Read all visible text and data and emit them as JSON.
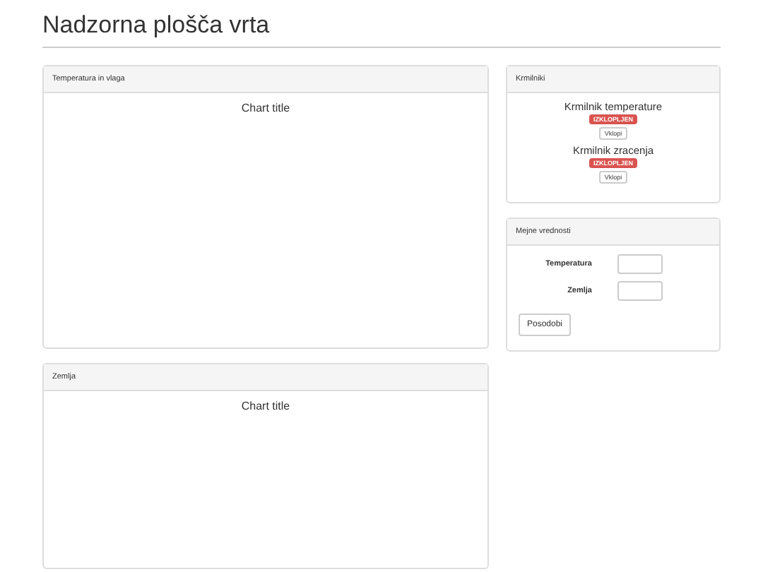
{
  "page_title": "Nadzorna plošča vrta",
  "charts": [
    {
      "heading": "Temperatura in vlaga",
      "chart_title": "Chart title"
    },
    {
      "heading": "Zemlja",
      "chart_title": "Chart title"
    }
  ],
  "controllers": {
    "heading": "Krmilniki",
    "items": [
      {
        "name": "Krmilnik temperature",
        "status": "IZKLOPLJEN",
        "on": false,
        "button": "Vklopi"
      },
      {
        "name": "Krmilnik zracenja",
        "status": "IZKLOPLJEN",
        "on": false,
        "button": "Vklopi"
      }
    ]
  },
  "limits": {
    "heading": "Mejne vrednosti",
    "fields": [
      {
        "label": "Temperatura"
      },
      {
        "label": "Zemlja"
      }
    ],
    "button": "Posodobi"
  }
}
